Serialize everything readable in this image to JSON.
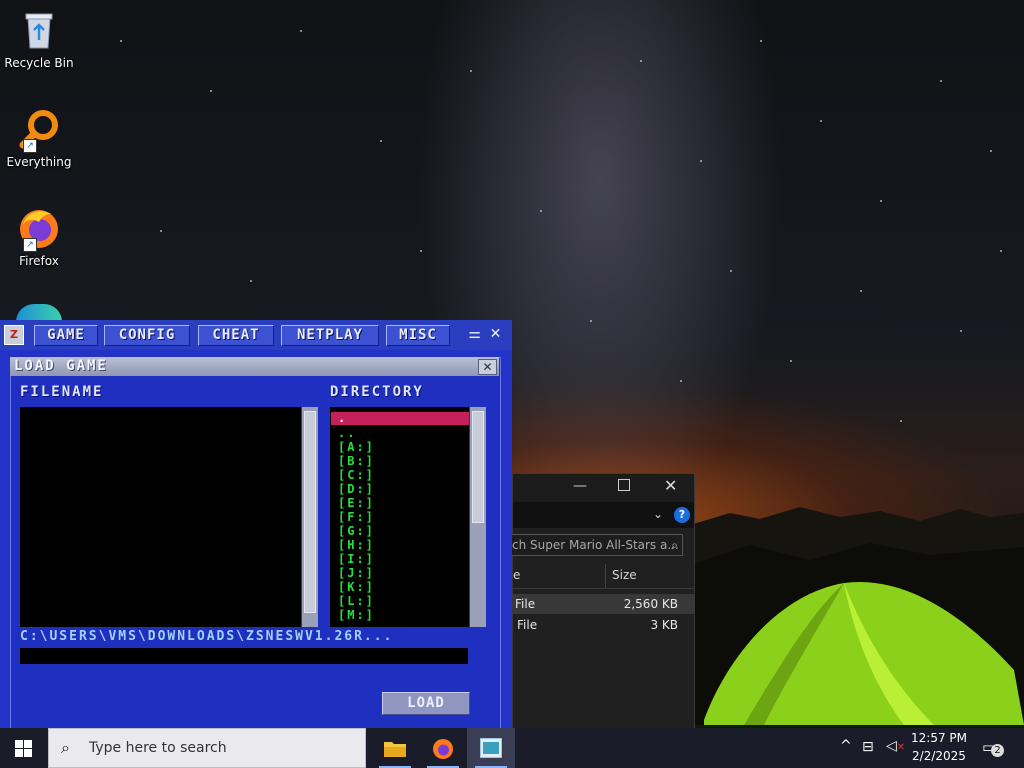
{
  "desktop": {
    "icons": [
      {
        "label": "Recycle Bin"
      },
      {
        "label": "Everything"
      },
      {
        "label": "Firefox"
      }
    ]
  },
  "zsnes": {
    "menu": [
      "GAME",
      "CONFIG",
      "CHEAT",
      "NETPLAY",
      "MISC"
    ],
    "dialog_title": "LOAD GAME",
    "filename_label": "FILENAME",
    "directory_label": "DIRECTORY",
    "directory_selected": ".",
    "directory_items": [
      "..",
      "[A:]",
      "[B:]",
      "[C:]",
      "[D:]",
      "[E:]",
      "[F:]",
      "[G:]",
      "[H:]",
      "[I:]",
      "[J:]",
      "[K:]",
      "[L:]",
      "[M:]"
    ],
    "path": "C:\\USERS\\VMS\\DOWNLOADS\\ZSNESWV1.26R...",
    "load_button": "LOAD",
    "colors": {
      "menu_bg": "#2a3ec0",
      "dir_text": "#26e03a",
      "selection": "#c4205a"
    }
  },
  "explorer": {
    "search_placeholder": "ch Super Mario All-Stars a...",
    "col_name": "e",
    "col_size": "Size",
    "rows": [
      {
        "type": "File",
        "size": "2,560 KB"
      },
      {
        "type": "File",
        "size": "3 KB"
      }
    ]
  },
  "taskbar": {
    "search_placeholder": "Type here to search",
    "time": "12:57 PM",
    "date": "2/2/2025",
    "notifications": "2"
  }
}
